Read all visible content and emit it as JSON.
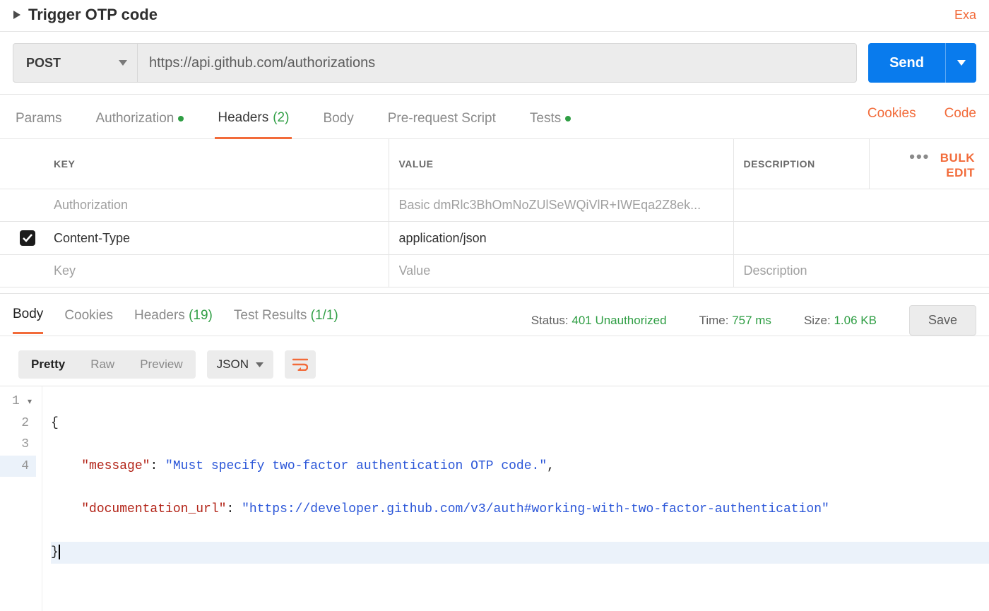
{
  "title": "Trigger OTP code",
  "topRightLink": "Exa",
  "request": {
    "method": "POST",
    "url": "https://api.github.com/authorizations",
    "sendLabel": "Send"
  },
  "reqTabs": {
    "params": "Params",
    "authorization": "Authorization",
    "headers": "Headers",
    "headersCount": "(2)",
    "body": "Body",
    "preRequest": "Pre-request Script",
    "tests": "Tests",
    "cookies": "Cookies",
    "code": "Code"
  },
  "headersTable": {
    "cols": {
      "key": "Key",
      "value": "Value",
      "desc": "Description"
    },
    "bulkEdit": "Bulk Edit",
    "rows": [
      {
        "checked": false,
        "muted": true,
        "key": "Authorization",
        "value": "Basic dmRlc3BhOmNoZUlSeWQiVlR+IWEqa2Z8ek...",
        "desc": ""
      },
      {
        "checked": true,
        "muted": false,
        "key": "Content-Type",
        "value": "application/json",
        "desc": ""
      }
    ],
    "placeholders": {
      "key": "Key",
      "value": "Value",
      "desc": "Description"
    }
  },
  "respTabs": {
    "body": "Body",
    "cookies": "Cookies",
    "headers": "Headers",
    "headersCount": "(19)",
    "testResults": "Test Results",
    "testResultsCount": "(1/1)"
  },
  "respMeta": {
    "statusLabel": "Status:",
    "statusValue": "401 Unauthorized",
    "timeLabel": "Time:",
    "timeValue": "757 ms",
    "sizeLabel": "Size:",
    "sizeValue": "1.06 KB",
    "save": "Save"
  },
  "respToolbar": {
    "pretty": "Pretty",
    "raw": "Raw",
    "preview": "Preview",
    "format": "JSON"
  },
  "responseBody": {
    "message_key": "\"message\"",
    "message_val": "\"Must specify two-factor authentication OTP code.\"",
    "doc_key": "\"documentation_url\"",
    "doc_val": "\"https://developer.github.com/v3/auth#working-with-two-factor-authentication\"",
    "lines": [
      "1",
      "2",
      "3",
      "4"
    ]
  }
}
